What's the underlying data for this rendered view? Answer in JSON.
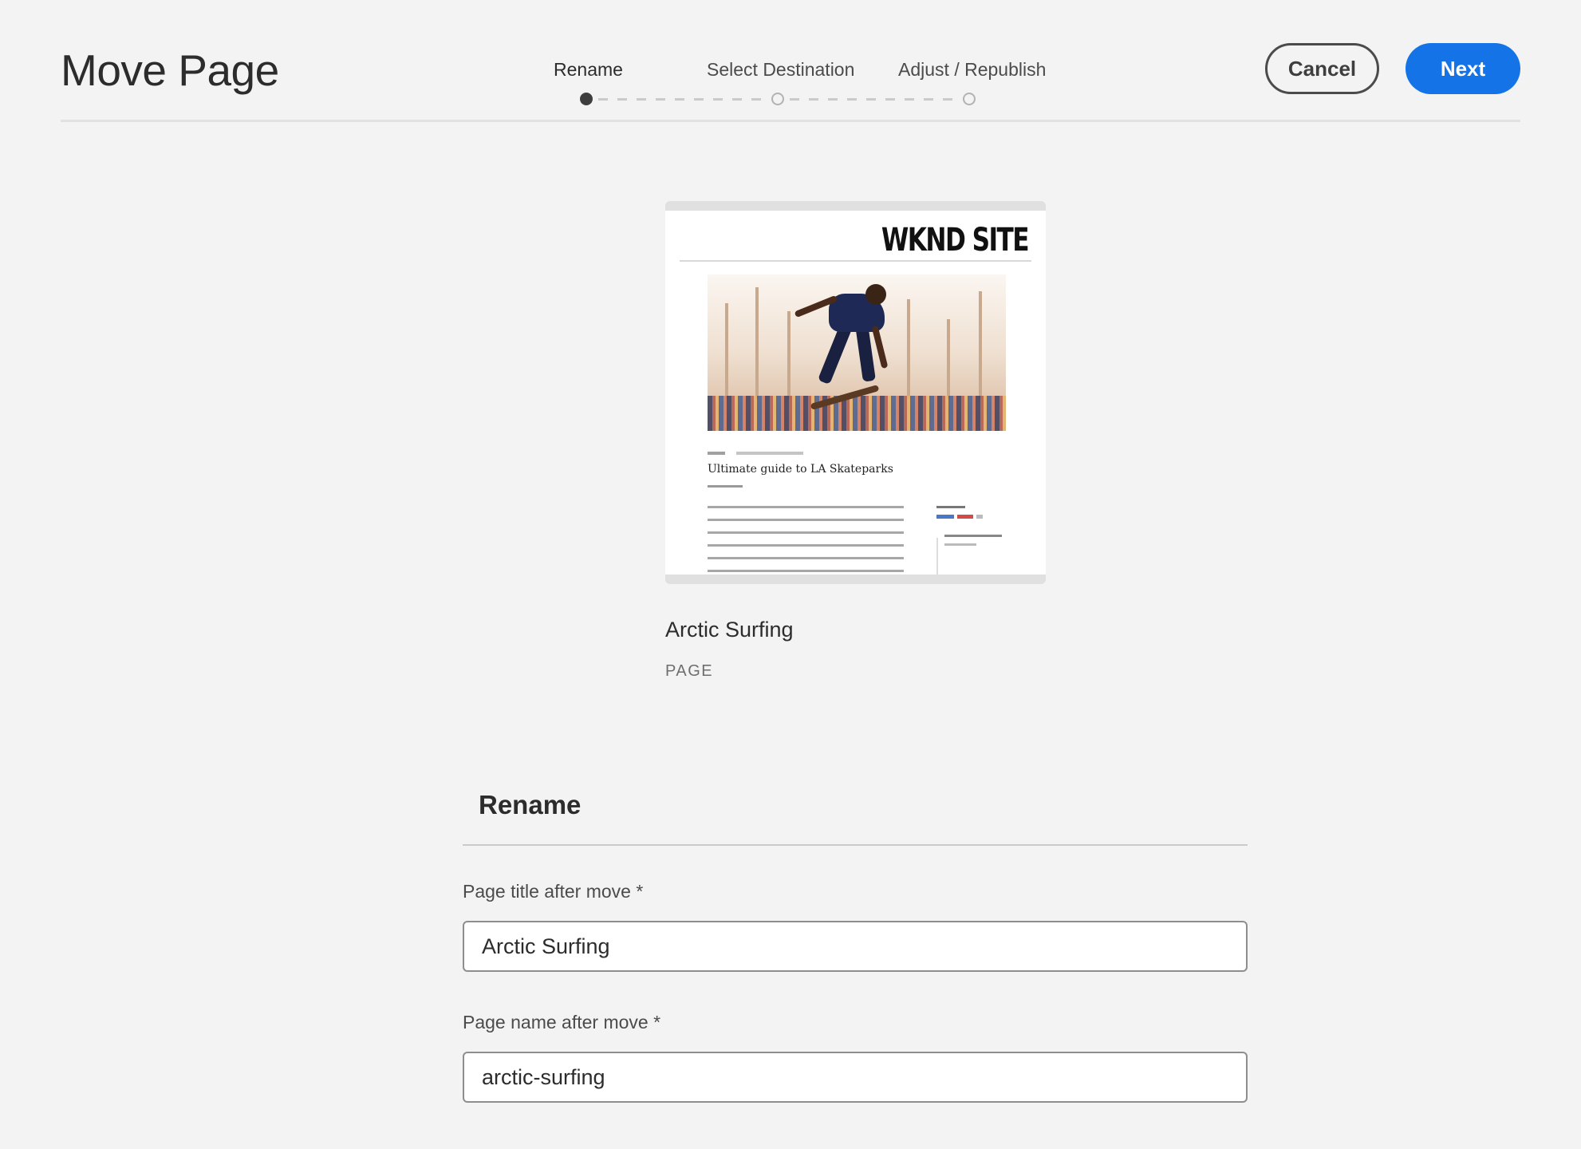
{
  "header": {
    "title": "Move Page",
    "steps": [
      {
        "label": "Rename",
        "state": "current"
      },
      {
        "label": "Select Destination",
        "state": "upcoming"
      },
      {
        "label": "Adjust / Republish",
        "state": "upcoming"
      }
    ],
    "cancel_label": "Cancel",
    "next_label": "Next"
  },
  "preview": {
    "site_logo": "WKND SITE",
    "article_title": "Ultimate guide to LA Skateparks",
    "item_name": "Arctic Surfing",
    "item_type": "PAGE"
  },
  "rename": {
    "heading": "Rename",
    "title_label": "Page title after move *",
    "title_value": "Arctic Surfing",
    "name_label": "Page name after move *",
    "name_value": "arctic-surfing"
  },
  "colors": {
    "accent": "#1473e6",
    "background": "#f3f3f3"
  }
}
